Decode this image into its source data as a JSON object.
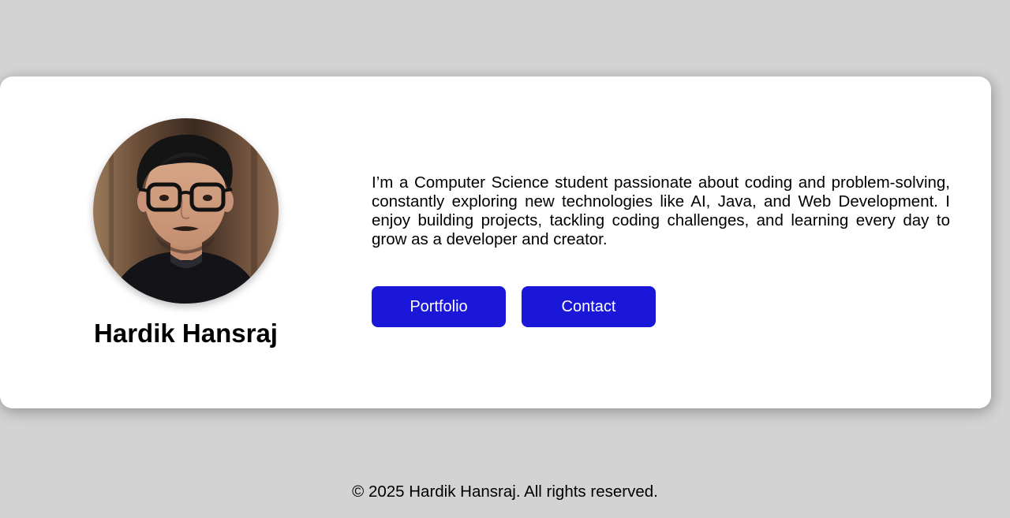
{
  "profile": {
    "name": "Hardik Hansraj",
    "avatar_alt": "Profile photo"
  },
  "about": {
    "text": "I’m a Computer Science student passionate about coding and problem-solving, constantly exploring new technologies like AI, Java, and Web Development. I enjoy building projects, tackling coding challenges, and learning every day to grow as a developer and creator."
  },
  "buttons": {
    "portfolio_label": "Portfolio",
    "contact_label": "Contact"
  },
  "footer": {
    "text": "© 2025 Hardik Hansraj. All rights reserved."
  },
  "colors": {
    "background": "#d3d3d3",
    "card": "#ffffff",
    "button": "#1a17d9",
    "button_text": "#ffffff"
  }
}
